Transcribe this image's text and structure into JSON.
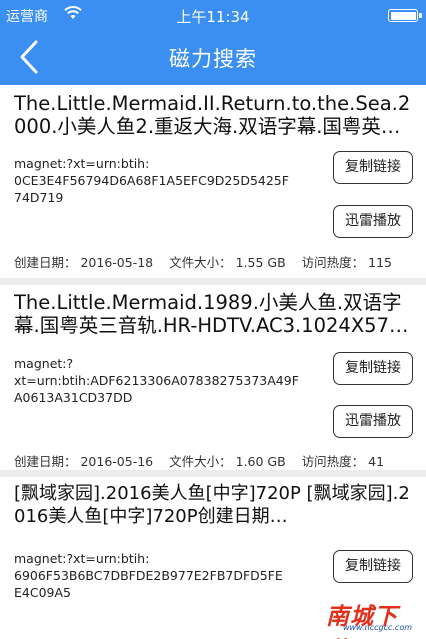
{
  "status_bar": {
    "carrier": "运营商",
    "wifi_icon": "wifi-icon",
    "time": "上午11:34",
    "battery_icon": "battery-icon"
  },
  "nav": {
    "back_icon": "chevron-left-icon",
    "title": "磁力搜索"
  },
  "results": [
    {
      "name": "The.Little.Mermaid.II.Return.to.the.Sea.2000.小美人鱼2.重返大海.双语字幕.国粤英…",
      "magnet": "magnet:?xt=urn:btih:\n0CE3E4F56794D6A68F1A5EFC9D25D5425F\n74D719",
      "copy_label": "复制链接",
      "play_label": "迅雷播放",
      "created": "创建日期：  2016-05-18",
      "size": "文件大小：  1.55 GB",
      "heat": "访问热度：  115"
    },
    {
      "name": "The.Little.Mermaid.1989.小美人鱼.双语字幕.国粤英三音轨.HR-HDTV.AC3.1024X57…",
      "magnet": "magnet:?\nxt=urn:btih:ADF6213306A07838275373A49F\nA0613A31CD37DD",
      "copy_label": "复制链接",
      "play_label": "迅雷播放",
      "created": "创建日期：  2016-05-16",
      "size": "文件大小：  1.60 GB",
      "heat": "访问热度：  41"
    },
    {
      "name": "[飘域家园].2016美人鱼[中字]720P [飘域家园].2016美人鱼[中字]720P创建日期…",
      "magnet": "magnet:?xt=urn:btih:\n6906F53B6BC7DBFDE2B977E2FB7DFD5FE\nE4C09A5",
      "copy_label": "复制链接"
    }
  ],
  "watermark": {
    "text": "南城下载",
    "url": "www.nccgcc.com"
  }
}
